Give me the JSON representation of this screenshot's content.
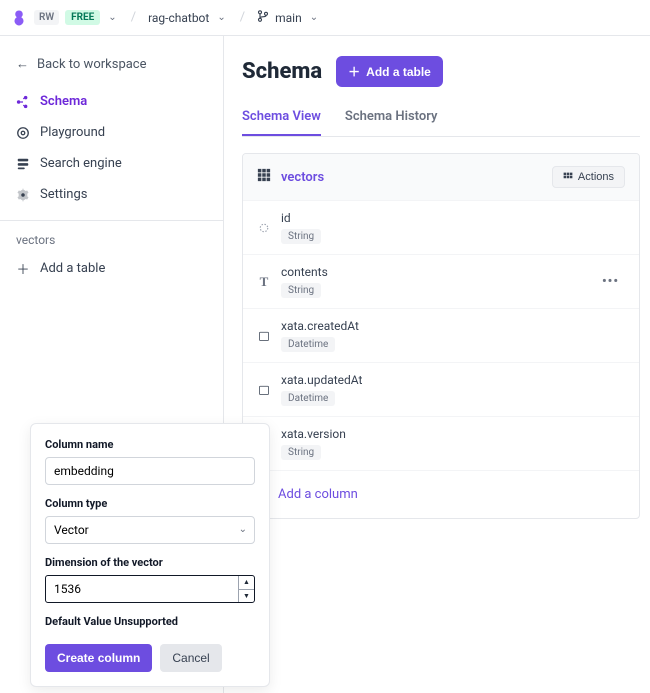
{
  "colors": {
    "primary": "#6d4de0"
  },
  "topbar": {
    "workspace_badge": "RW",
    "plan_badge": "FREE",
    "project": "rag-chatbot",
    "branch": "main"
  },
  "sidebar": {
    "back_label": "Back to workspace",
    "nav": [
      {
        "label": "Schema",
        "icon": "schema"
      },
      {
        "label": "Playground",
        "icon": "playground"
      },
      {
        "label": "Search engine",
        "icon": "search-engine"
      },
      {
        "label": "Settings",
        "icon": "settings"
      }
    ],
    "table_ref": "vectors",
    "add_table_label": "Add a table"
  },
  "main": {
    "title": "Schema",
    "add_table_btn": "Add a table",
    "tabs": [
      {
        "label": "Schema View",
        "active": true
      },
      {
        "label": "Schema History",
        "active": false
      }
    ]
  },
  "table": {
    "name": "vectors",
    "actions_label": "Actions",
    "columns": [
      {
        "name": "id",
        "type": "String",
        "icon": "id"
      },
      {
        "name": "contents",
        "type": "String",
        "icon": "text",
        "more_visible": true
      },
      {
        "name": "xata.createdAt",
        "type": "Datetime",
        "icon": "datetime"
      },
      {
        "name": "xata.updatedAt",
        "type": "Datetime",
        "icon": "datetime"
      },
      {
        "name": "xata.version",
        "type": "String",
        "icon": "text"
      }
    ],
    "add_column_label": "Add a column"
  },
  "popover": {
    "name_label": "Column name",
    "name_value": "embedding",
    "type_label": "Column type",
    "type_value": "Vector",
    "dim_label": "Dimension of the vector",
    "dim_value": "1536",
    "default_hint": "Default Value Unsupported",
    "create_label": "Create column",
    "cancel_label": "Cancel"
  }
}
